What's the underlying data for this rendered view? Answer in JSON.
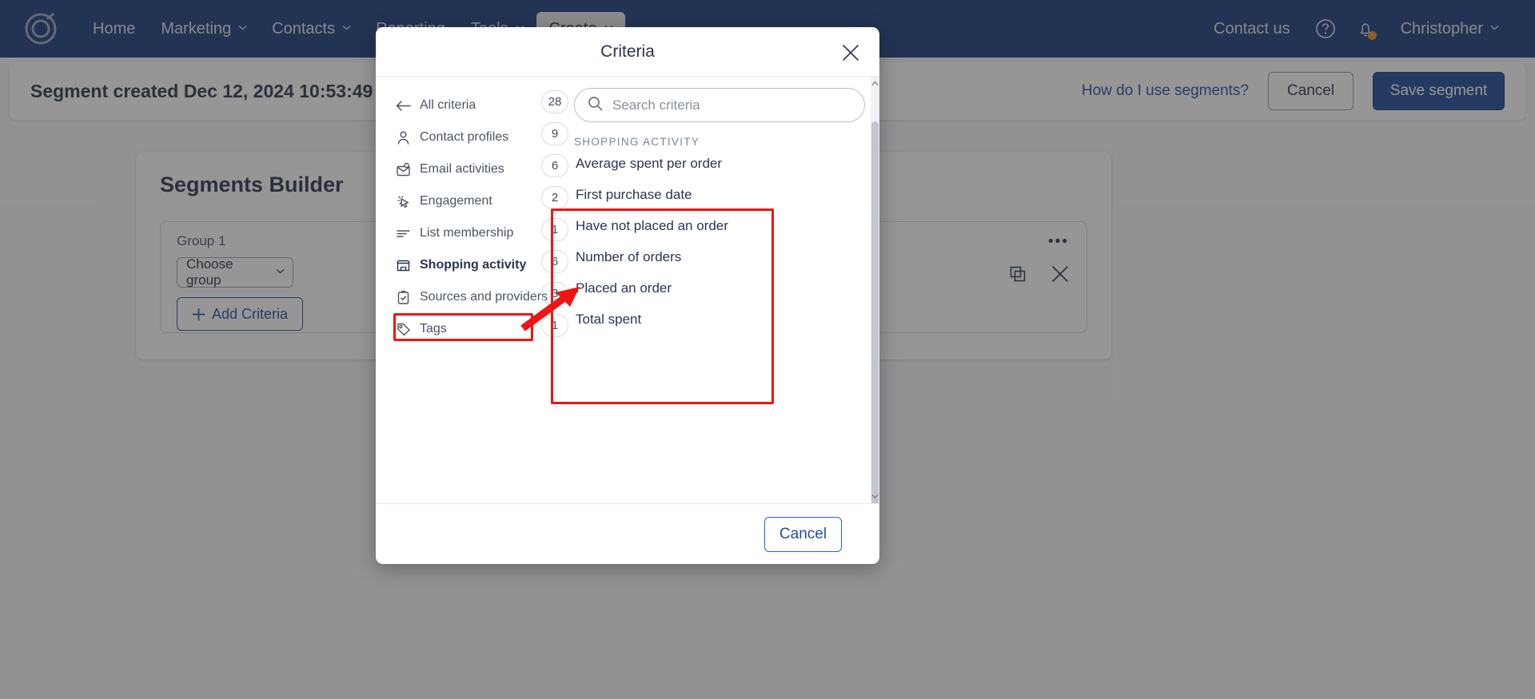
{
  "topnav": {
    "logo_name": "constant-contact-logo",
    "items": [
      {
        "label": "Home",
        "has_caret": false
      },
      {
        "label": "Marketing",
        "has_caret": true
      },
      {
        "label": "Contacts",
        "has_caret": true
      },
      {
        "label": "Reporting",
        "has_caret": false
      },
      {
        "label": "Tools",
        "has_caret": true
      },
      {
        "label": "Create",
        "has_caret": true
      }
    ],
    "contact_us": "Contact us",
    "help_icon": "question-mark-circle-icon",
    "notifications_icon": "bell-icon",
    "account_name": "Christopher",
    "notification_dot_color": "#e8901e"
  },
  "subheader": {
    "created_label": "Segment created Dec 12, 2024 10:53:49",
    "help_link": "How do I use segments?",
    "cancel_label": "Cancel",
    "save_label": "Save segment"
  },
  "builder": {
    "title": "Segments Builder",
    "group_label": "Group 1",
    "choose_group_label": "Choose group",
    "add_criteria_label": "Add Criteria",
    "more_menu": "•••",
    "copy_icon": "copy-icon",
    "remove_icon": "close-x-icon"
  },
  "modal": {
    "title": "Criteria",
    "close_icon": "close-x-icon",
    "back_label": "All criteria",
    "categories": [
      {
        "label": "All criteria",
        "icon": "arrow-left-icon",
        "count": "28",
        "selected": false
      },
      {
        "label": "Contact profiles",
        "icon": "person-icon",
        "count": "9",
        "selected": false
      },
      {
        "label": "Email activities",
        "icon": "envelope-icon",
        "count": "",
        "selected": false
      },
      {
        "label": "Engagement",
        "icon": "cursor-click-icon",
        "count": "",
        "selected": false
      },
      {
        "label": "List membership",
        "icon": "list-lines-icon",
        "count": "",
        "selected": false
      },
      {
        "label": "Shopping activity",
        "icon": "storefront-icon",
        "count": "",
        "selected": true
      },
      {
        "label": "Sources and providers",
        "icon": "clipboard-check-icon",
        "count": "",
        "selected": false
      },
      {
        "label": "Tags",
        "icon": "tag-icon",
        "count": "",
        "selected": false
      }
    ],
    "search": {
      "placeholder": "Search criteria",
      "value": "",
      "icon": "search-icon"
    },
    "section_label": "SHOPPING ACTIVITY",
    "criteria": [
      {
        "count": "6",
        "label": "Average spent per order"
      },
      {
        "count": "2",
        "label": "First purchase date"
      },
      {
        "count": "1",
        "label": "Have not placed an order"
      },
      {
        "count": "6",
        "label": "Number of orders"
      },
      {
        "count": "3",
        "label": "Placed an order"
      },
      {
        "count": "1",
        "label": "Total spent"
      }
    ],
    "footer_cancel": "Cancel",
    "highlight_color": "#f01414"
  }
}
